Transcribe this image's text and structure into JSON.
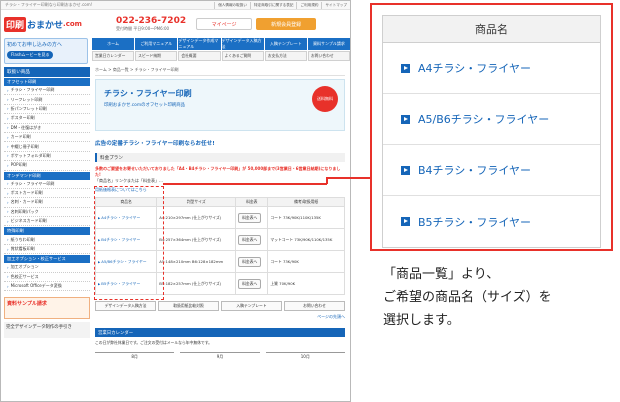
{
  "browser": {
    "topbar_text": "チラシ・フライヤー印刷なら印刷おまかせ.com!",
    "top_links": [
      "個人情報の取扱い",
      "特定商取引に関する表記",
      "ご利用規約",
      "サイトマップ"
    ]
  },
  "header": {
    "logo_mark": "印刷",
    "logo_text": "おまかせ",
    "logo_com": ".com",
    "tel_label": "受付時間 平日9:00〜PM6:00",
    "tel": "022-236-7202",
    "mypage": "マイページ",
    "member_button": "新規会員登録"
  },
  "beginner": {
    "title": "初めてお申し込みの方へ",
    "pill": "Flashムービーを見る"
  },
  "nav": {
    "primary": [
      "ホーム",
      "ご利用マニュアル",
      "デザインデータ作成マニュアル",
      "デザインデータ入稿方法",
      "入稿テンプレート",
      "資料サンプル請求"
    ],
    "secondary": [
      "営業日カレンダー",
      "スピード納期",
      "会社概要",
      "よくあるご質問",
      "お支払方法",
      "お問い合わせ"
    ]
  },
  "sidebar": {
    "title": "取扱い商品",
    "offset_label": "オフセット印刷",
    "offset_items": [
      "チラシ・フライヤー印刷",
      "リーフレット印刷",
      "折パンフレット印刷",
      "ポスター印刷",
      "DM・往復はがき",
      "カード印刷",
      "中綴じ冊子印刷",
      "ポケットフォルダ印刷",
      "POP印刷"
    ],
    "ondemand_label": "オンデマンド印刷",
    "ondemand_items": [
      "チラシ・フライヤー印刷",
      "ポストカード印刷",
      "名刺・カード印刷",
      "名刺印刷パック",
      "ビジネスカード印刷"
    ],
    "special_label": "特殊印刷",
    "special_items": [
      "紙うちわ印刷",
      "賞状看板印刷"
    ],
    "option_label": "加工オプション・校正サービス",
    "option_items": [
      "加工オプション",
      "色校正サービス",
      "Microsoft Officeデータ変換"
    ],
    "promo": "資料サンプル請求",
    "promo2": "完全デザインデータ制作の手引き"
  },
  "main": {
    "breadcrumb": "ホーム > 商品一覧 > チラシ・フライヤー印刷",
    "banner_title": "チラシ・フライヤー印刷",
    "banner_sub": "印刷おまかせ.comのオフセット印刷商品",
    "banner_circle": "送料無料",
    "heading": "広告の定番チラシ・フライヤー印刷ならお任せ!",
    "plan_label": "料金プラン",
    "red_note": "多数のご要望をお寄せいただいておりました「A4・B4チラシ・フライヤー印刷」が 50,000部まで(3営業日・6営業日納期)になりました!",
    "note": "「商品名」リンクまたは「料金表」…",
    "paper_link": "用紙価格表についてはこちら",
    "table_headers": [
      "商品名",
      "判型サイズ",
      "料金表",
      "備考/取扱用紙"
    ],
    "rows": [
      {
        "name": "A4チラシ・フライヤー",
        "size": "A4:210×297mm (仕上がりサイズ)",
        "btn": "料金表へ",
        "paper": "コート 73K/90K/110K/135K"
      },
      {
        "name": "B4チラシ・フライヤー",
        "size": "B4:257×364mm (仕上がりサイズ)",
        "btn": "料金表へ",
        "paper": "マットコート 73K/90K/110K/135K"
      },
      {
        "name": "A5/B6チラシ・フライヤー",
        "size": "A5:148×210mm B6:128×182mm",
        "btn": "料金表へ",
        "paper": "コート 73K/90K"
      },
      {
        "name": "B5チラシ・フライヤー",
        "size": "B5:182×257mm (仕上がりサイズ)",
        "btn": "料金表へ",
        "paper": "上質 70K/90K"
      }
    ],
    "bottom_buttons": [
      "デザインデータ入稿方法",
      "取扱用紙比較対照",
      "入稿テンプレート",
      "お問い合わせ"
    ],
    "page_top": "ページの先頭へ",
    "calendar_title": "営業日カレンダー",
    "calendar_note": "この日が弊社休業日です。ご注文の受付はメールなら年中無休です。",
    "months": [
      "8月",
      "9月",
      "10月"
    ]
  },
  "zoom": {
    "header": "商品名",
    "items": [
      "A4チラシ・フライヤー",
      "A5/B6チラシ・フライヤー",
      "B4チラシ・フライヤー",
      "B5チラシ・フライヤー"
    ]
  },
  "caption": {
    "lines": [
      "「商品一覧」より、",
      "ご希望の商品名（サイズ）を",
      "選択します。"
    ]
  },
  "colors": {
    "accent_red": "#e8312a",
    "brand_blue": "#1565b8"
  }
}
